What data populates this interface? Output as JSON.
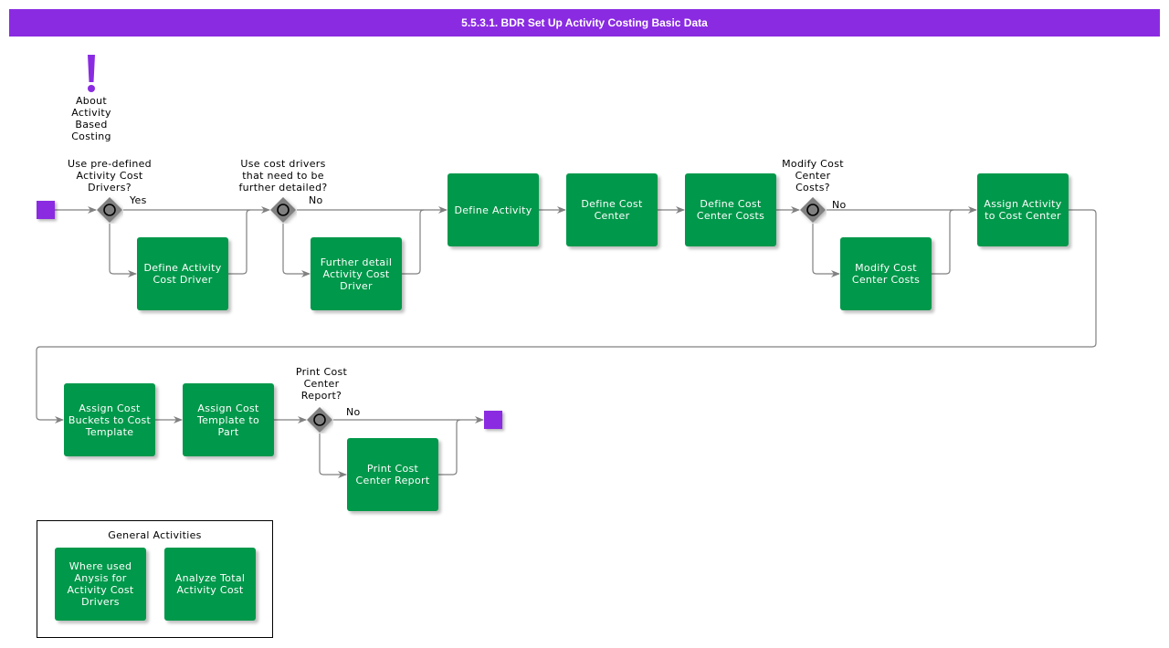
{
  "header": {
    "title": "5.5.3.1. BDR Set Up Activity Costing Basic Data"
  },
  "colors": {
    "accent": "#8a2be2",
    "task": "#00984a",
    "gateway": "#808080",
    "connector": "#808080"
  },
  "annotation": {
    "icon": "exclamation-icon",
    "label": "About\nActivity\nBased\nCosting"
  },
  "events": {
    "start": "start-event",
    "end": "end-event"
  },
  "gateways": [
    {
      "question": "Use pre-defined\nActivity Cost\nDrivers?",
      "branch_label": "Yes"
    },
    {
      "question": "Use cost drivers\nthat need to be\nfurther detailed?",
      "branch_label": "No"
    },
    {
      "question": "Modify Cost\nCenter\nCosts?",
      "branch_label": "No"
    },
    {
      "question": "Print Cost\nCenter\nReport?",
      "branch_label": "No"
    }
  ],
  "tasks": [
    {
      "label": "Define Activity\nCost Driver"
    },
    {
      "label": "Further detail\nActivity Cost\nDriver"
    },
    {
      "label": "Define Activity"
    },
    {
      "label": "Define Cost\nCenter"
    },
    {
      "label": "Define Cost\nCenter Costs"
    },
    {
      "label": "Modify Cost\nCenter Costs"
    },
    {
      "label": "Assign Activity\nto Cost Center"
    },
    {
      "label": "Assign Cost\nBuckets to Cost\nTemplate"
    },
    {
      "label": "Assign Cost\nTemplate to Part"
    },
    {
      "label": "Print Cost\nCenter Report"
    }
  ],
  "general_activities": {
    "title": "General Activities",
    "items": [
      {
        "label": "Where used\nAnysis for\nActivity Cost\nDrivers"
      },
      {
        "label": "Analyze Total\nActivity Cost"
      }
    ]
  }
}
